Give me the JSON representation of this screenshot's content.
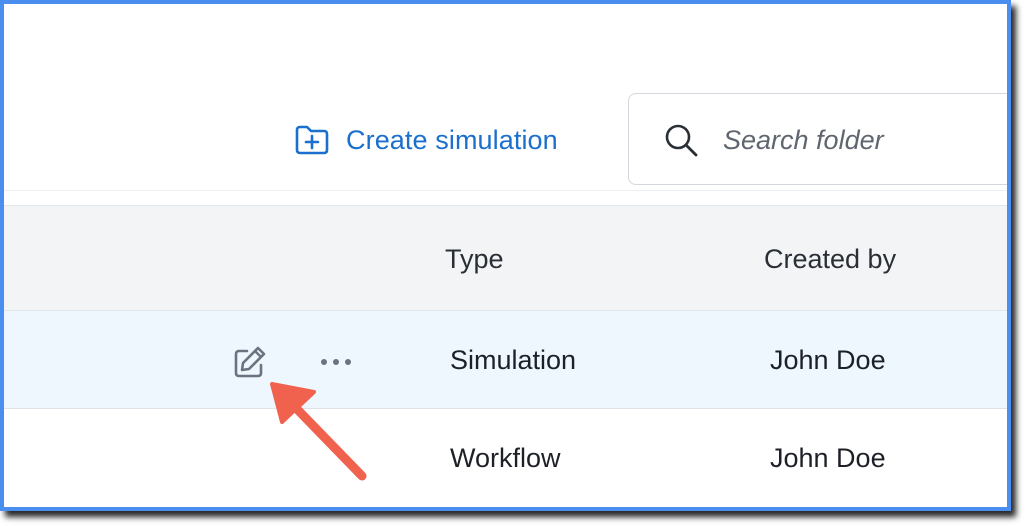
{
  "toolbar": {
    "create_label": "Create simulation",
    "create_icon": "folder-plus-icon",
    "search_icon": "search-icon",
    "search_placeholder": "Search folder"
  },
  "table": {
    "columns": [
      "Type",
      "Created by"
    ],
    "rows": [
      {
        "type": "Simulation",
        "created_by": "John Doe",
        "highlighted": true
      },
      {
        "type": "Workflow",
        "created_by": "John Doe",
        "highlighted": false
      }
    ],
    "row_action_icons": [
      "edit-icon",
      "more-options-icon"
    ]
  },
  "annotation": {
    "icon": "arrow-icon",
    "color": "#f0624d"
  },
  "colors": {
    "accent": "#1b6fcd",
    "frame_border": "#4a8ff0",
    "header_bg": "#f3f4f6",
    "selected_row_bg": "#eef6fe",
    "icon_gray": "#6b7280"
  }
}
